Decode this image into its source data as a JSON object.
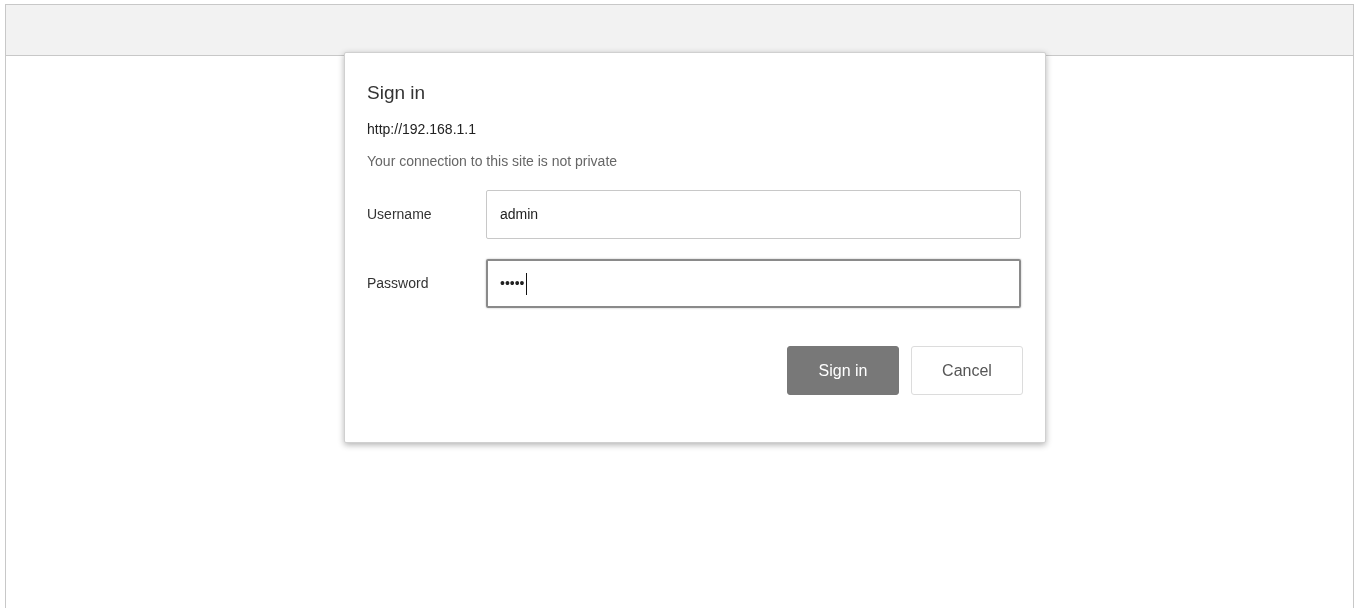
{
  "dialog": {
    "title": "Sign in",
    "url": "http://192.168.1.1",
    "warning": "Your connection to this site is not private",
    "fields": [
      {
        "label": "Username",
        "value": "admin",
        "focused": false
      },
      {
        "label": "Password",
        "value": "•••••",
        "focused": true
      }
    ],
    "buttons": [
      {
        "label": "Sign in",
        "kind": "primary"
      },
      {
        "label": "Cancel",
        "kind": "secondary"
      }
    ]
  }
}
